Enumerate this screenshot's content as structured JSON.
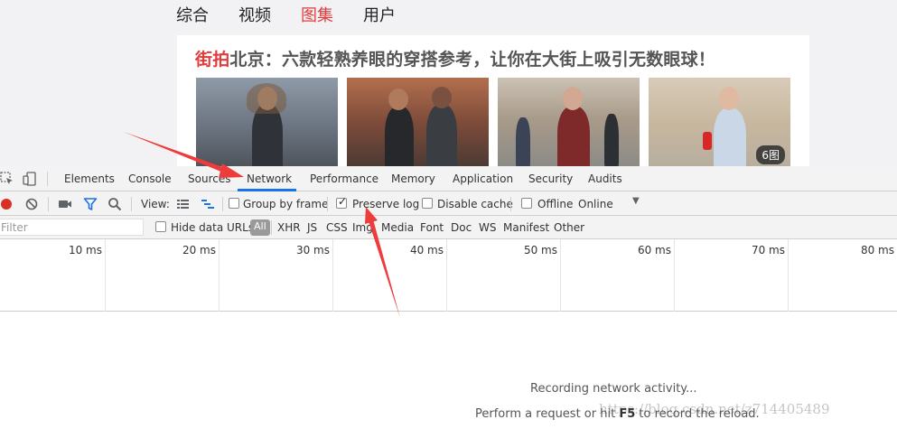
{
  "page": {
    "nav": [
      {
        "label": "综合",
        "active": false
      },
      {
        "label": "视频",
        "active": false
      },
      {
        "label": "图集",
        "active": true
      },
      {
        "label": "用户",
        "active": false
      }
    ],
    "headline_tag": "街拍",
    "headline_rest": "北京：六款轻熟养眼的穿搭参考，让你在大街上吸引无数眼球！",
    "image_count_badge": "6图",
    "accent_color": "#e03c3c"
  },
  "devtools": {
    "tabs": [
      "Elements",
      "Console",
      "Sources",
      "Network",
      "Performance",
      "Memory",
      "Application",
      "Security",
      "Audits"
    ],
    "active_tab": "Network",
    "toolbar": {
      "view_label": "View:",
      "group_by_frame": "Group by frame",
      "preserve_log": "Preserve log",
      "disable_cache": "Disable cache",
      "offline": "Offline",
      "throttle_value": "Online"
    },
    "filter": {
      "placeholder": "Filter",
      "hide_data_urls": "Hide data URLs",
      "types": [
        "All",
        "XHR",
        "JS",
        "CSS",
        "Img",
        "Media",
        "Font",
        "Doc",
        "WS",
        "Manifest",
        "Other"
      ]
    },
    "timeline_ticks": [
      "10 ms",
      "20 ms",
      "30 ms",
      "40 ms",
      "50 ms",
      "60 ms",
      "70 ms",
      "80 ms"
    ],
    "empty_state": {
      "recording": "Recording network activity...",
      "perform_prefix": "Perform a request or hit ",
      "perform_key": "F5",
      "perform_suffix": " to record the reload."
    }
  },
  "watermark": "https://blog.csdn.net/z714405489",
  "colors": {
    "record_red": "#d93025",
    "active_blue": "#1a73e8",
    "arrow_red": "#ee3b3b"
  },
  "icons": [
    "inspect-icon",
    "device-icon",
    "record-icon",
    "clear-icon",
    "camera-icon",
    "filter-icon",
    "search-icon",
    "list-view-icon",
    "waterfall-view-icon",
    "dropdown-arrow-icon"
  ]
}
